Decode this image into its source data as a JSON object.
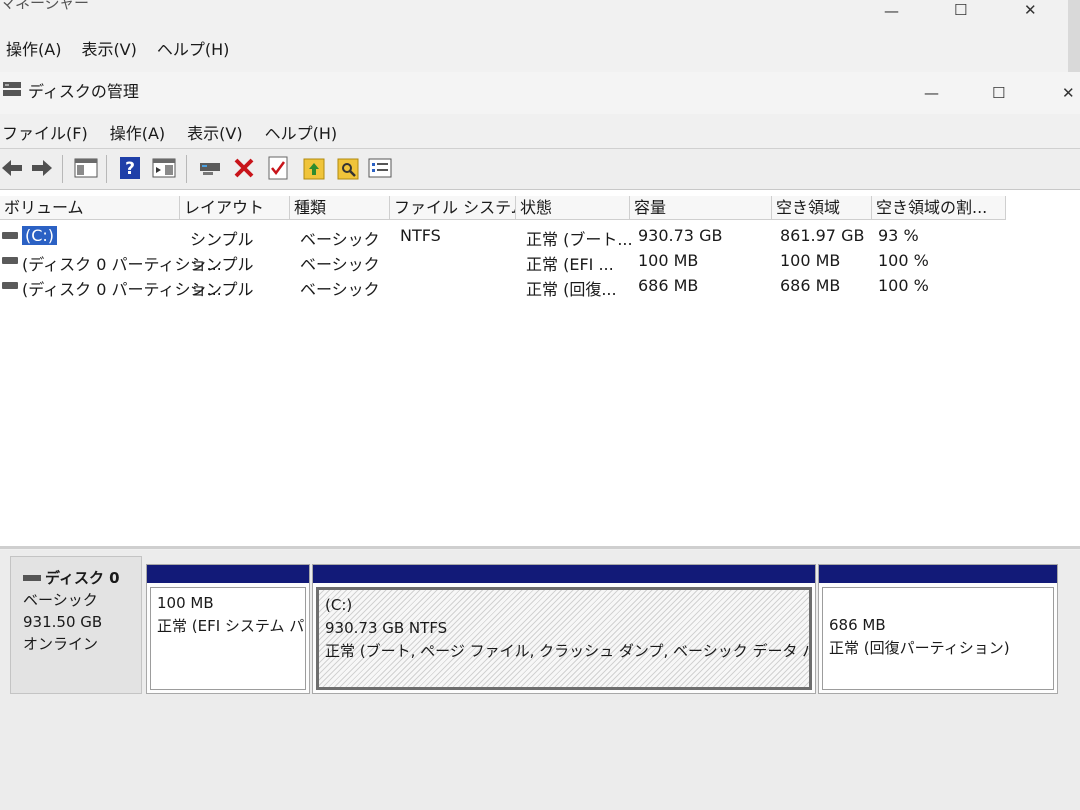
{
  "outer_window": {
    "title": "マネージャー",
    "menu": [
      "操作(A)",
      "表示(V)",
      "ヘルプ(H)"
    ]
  },
  "window": {
    "title": "ディスクの管理",
    "menu": [
      "ファイル(F)",
      "操作(A)",
      "表示(V)",
      "ヘルプ(H)"
    ]
  },
  "toolbar_icons": [
    "back-arrow-icon",
    "forward-arrow-icon",
    "console-tree-icon",
    "help-icon",
    "show-pane-icon",
    "connect-disk-icon",
    "delete-icon",
    "check-icon",
    "folder-up-icon",
    "folder-search-icon",
    "properties-icon"
  ],
  "columns": [
    "ボリューム",
    "レイアウト",
    "種類",
    "ファイル システム",
    "状態",
    "容量",
    "空き領域",
    "空き領域の割..."
  ],
  "volumes": [
    {
      "name": "(C:)",
      "layout": "シンプル",
      "type": "ベーシック",
      "fs": "NTFS",
      "status": "正常 (ブート...",
      "capacity": "930.73 GB",
      "free": "861.97 GB",
      "pct": "93 %"
    },
    {
      "name": "(ディスク 0 パーティショ...",
      "layout": "シンプル",
      "type": "ベーシック",
      "fs": "",
      "status": "正常 (EFI ...",
      "capacity": "100 MB",
      "free": "100 MB",
      "pct": "100 %"
    },
    {
      "name": "(ディスク 0 パーティショ...",
      "layout": "シンプル",
      "type": "ベーシック",
      "fs": "",
      "status": "正常 (回復...",
      "capacity": "686 MB",
      "free": "686 MB",
      "pct": "100 %"
    }
  ],
  "disk": {
    "name": "ディスク 0",
    "type": "ベーシック",
    "size": "931.50 GB",
    "state": "オンライン"
  },
  "partitions": [
    {
      "label": "",
      "size": "100 MB",
      "status": "正常 (EFI システム パー"
    },
    {
      "label": "(C:)",
      "size": "930.73 GB NTFS",
      "status": "正常 (ブート, ページ ファイル, クラッシュ ダンプ, ベーシック データ パーティション)"
    },
    {
      "label": "",
      "size": "686 MB",
      "status": "正常 (回復パーティション)"
    }
  ],
  "colors": {
    "partition_header": "#121a78",
    "selection": "#2b61c4"
  }
}
